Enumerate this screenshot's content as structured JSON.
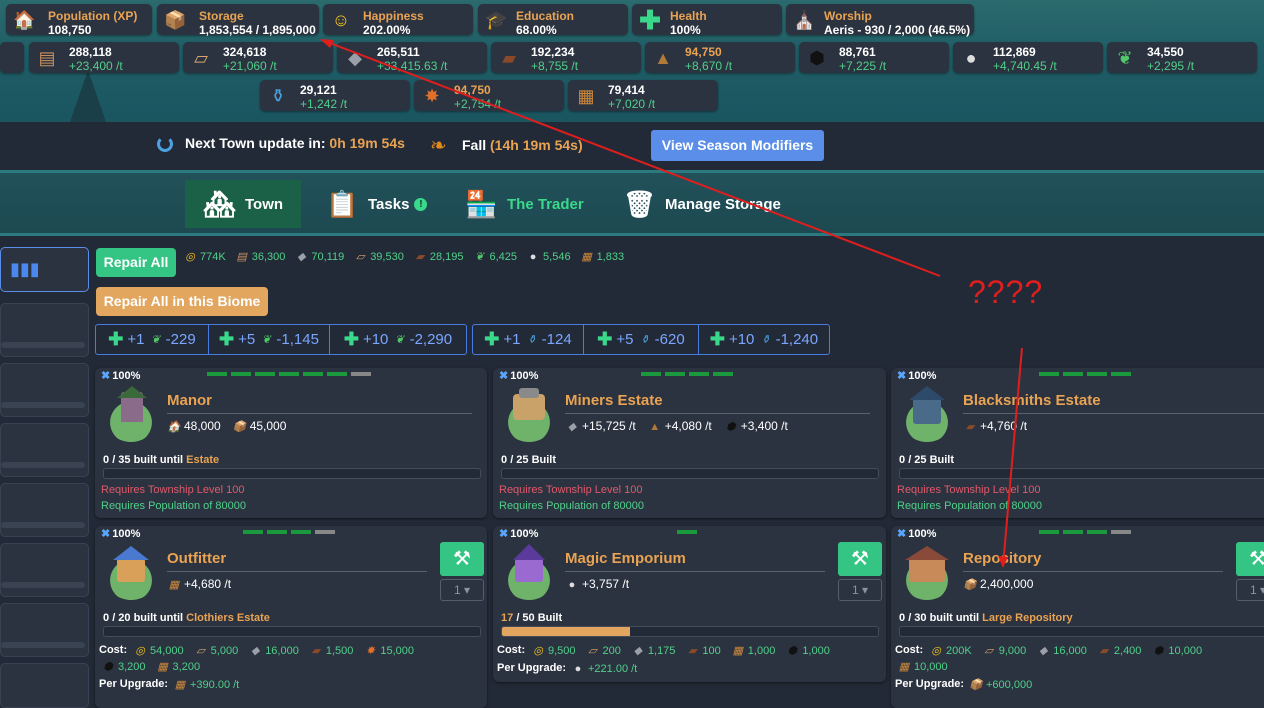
{
  "stats": [
    {
      "label": "Population (XP)",
      "value": "108,750",
      "icon": "house-icon"
    },
    {
      "label": "Storage",
      "value": "1,853,554 / 1,895,000",
      "icon": "crate-icon"
    },
    {
      "label": "Happiness",
      "value": "202.00%",
      "icon": "smiley-icon"
    },
    {
      "label": "Education",
      "value": "68.00%",
      "icon": "graduation-cap-icon"
    },
    {
      "label": "Health",
      "value": "100%",
      "icon": "health-cross-icon"
    },
    {
      "label": "Worship",
      "value": "Aeris - 930 / 2,000 (46.5%)",
      "icon": "temple-icon"
    }
  ],
  "resources_row1": [
    {
      "value": "288,118",
      "rate": "+23,400 /t",
      "icon": "logs-icon"
    },
    {
      "value": "324,618",
      "rate": "+21,060 /t",
      "icon": "plank-icon"
    },
    {
      "value": "265,511",
      "rate": "+33,415.63 /t",
      "icon": "stone-icon"
    },
    {
      "value": "192,234",
      "rate": "+8,755 /t",
      "icon": "iron-bar-icon"
    },
    {
      "value": "94,750",
      "rate": "+8,670 /t",
      "icon": "ore-pile-icon",
      "highlight": true
    },
    {
      "value": "88,761",
      "rate": "+7,225 /t",
      "icon": "coal-icon"
    },
    {
      "value": "112,869",
      "rate": "+4,740.45 /t",
      "icon": "pearl-icon"
    },
    {
      "value": "34,550",
      "rate": "+2,295 /t",
      "icon": "herb-icon"
    }
  ],
  "resources_row2": [
    {
      "value": "29,121",
      "rate": "+1,242 /t",
      "icon": "potion-icon"
    },
    {
      "value": "94,750",
      "rate": "+2,754 /t",
      "icon": "leather-icon",
      "highlight": true
    },
    {
      "value": "79,414",
      "rate": "+7,020 /t",
      "icon": "cloth-bundle-icon"
    }
  ],
  "infobar": {
    "next_label": "Next Town update in:",
    "next_time": "0h 19m 54s",
    "season": "Fall",
    "season_time": "(14h 19m 54s)",
    "season_btn": "View Season Modifiers"
  },
  "nav": {
    "town": "Town",
    "tasks": "Tasks",
    "trader": "The Trader",
    "storage": "Manage Storage"
  },
  "repair": {
    "all_label": "Repair All",
    "biome_label": "Repair All in this Biome",
    "costs": [
      {
        "v": "774K",
        "icon": "gold-coins-icon"
      },
      {
        "v": "36,300",
        "icon": "logs-icon"
      },
      {
        "v": "70,119",
        "icon": "stone-icon"
      },
      {
        "v": "39,530",
        "icon": "plank-icon"
      },
      {
        "v": "28,195",
        "icon": "iron-bar-icon"
      },
      {
        "v": "6,425",
        "icon": "herb-icon"
      },
      {
        "v": "5,546",
        "icon": "pearl-icon"
      },
      {
        "v": "1,833",
        "icon": "cloth-bundle-icon"
      }
    ]
  },
  "health_buttons_herb": [
    {
      "amt": "+1",
      "cost": "-229"
    },
    {
      "amt": "+5",
      "cost": "-1,145"
    },
    {
      "amt": "+10",
      "cost": "-2,290"
    }
  ],
  "health_buttons_potion": [
    {
      "amt": "+1",
      "cost": "-124"
    },
    {
      "amt": "+5",
      "cost": "-620"
    },
    {
      "amt": "+10",
      "cost": "-1,240"
    }
  ],
  "cards": [
    {
      "pct": "100%",
      "name": "Manor",
      "stats": [
        "48,000",
        "45,000"
      ],
      "built_count": "0",
      "built_total": "/ 35 built until",
      "built_target": "Estate",
      "req1": "Requires Township Level 100",
      "req2": "Requires Population of 80000",
      "progress": 0
    },
    {
      "pct": "100%",
      "name": "Miners Estate",
      "stats": [
        "+15,725 /t",
        "+4,080 /t",
        "+3,400 /t"
      ],
      "built_count": "0",
      "built_total": "/ 25 Built",
      "req1": "Requires Township Level 100",
      "req2": "Requires Population of 80000",
      "progress": 0
    },
    {
      "pct": "100%",
      "name": "Blacksmiths Estate",
      "stats": [
        "+4,760 /t"
      ],
      "built_count": "0",
      "built_total": "/ 25 Built",
      "req1": "Requires Township Level 100",
      "req2": "Requires Population of 80000",
      "progress": 0
    },
    {
      "pct": "100%",
      "name": "Outfitter",
      "stats": [
        "+4,680 /t"
      ],
      "built_count": "0",
      "built_total": "/ 20 built until",
      "built_target": "Clothiers Estate",
      "cost_label": "Cost:",
      "costs": [
        "54,000",
        "5,000",
        "16,000",
        "1,500",
        "15,000"
      ],
      "costs2": [
        "3,200",
        "3,200"
      ],
      "perup_label": "Per Upgrade:",
      "perup": "+390.00 /t",
      "qty": "1",
      "progress": 0
    },
    {
      "pct": "100%",
      "name": "Magic Emporium",
      "stats": [
        "+3,757 /t"
      ],
      "built_count": "17",
      "built_total": "/ 50 Built",
      "cost_label": "Cost:",
      "costs": [
        "9,500",
        "200",
        "1,175",
        "100",
        "1,000",
        "1,000"
      ],
      "perup_label": "Per Upgrade:",
      "perup": "+221.00 /t",
      "qty": "1",
      "progress": 0.34
    },
    {
      "pct": "100%",
      "name": "Repository",
      "stats": [
        "2,400,000"
      ],
      "built_count": "0",
      "built_total": "/ 30 built until",
      "built_target": "Large Repository",
      "cost_label": "Cost:",
      "costs": [
        "200K",
        "9,000",
        "16,000",
        "2,400",
        "10,000"
      ],
      "costs2": [
        "10,000"
      ],
      "perup_label": "Per Upgrade:",
      "perup": "+600,000",
      "qty": "1",
      "progress": 0
    }
  ],
  "annotation": "????",
  "colors": {
    "accent": "#e9a352",
    "green": "#34c584",
    "blue": "#5a8ee8",
    "card": "#2c3340",
    "bg": "#232a37",
    "arrow": "#e01e1e"
  }
}
